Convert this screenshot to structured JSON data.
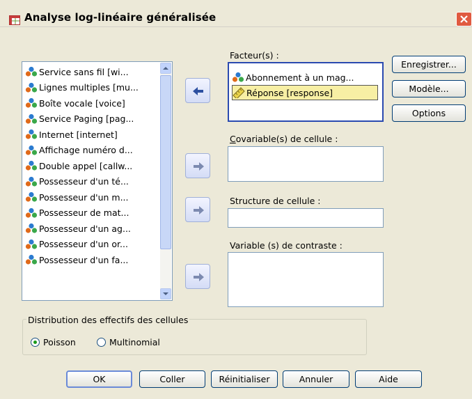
{
  "window": {
    "title": "Analyse log-linéaire généralisée"
  },
  "variables": [
    "Service sans fil [wi...",
    "Lignes multiples [mu...",
    "Boîte vocale [voice]",
    "Service Paging [pag...",
    "Internet [internet]",
    "Affichage numéro d...",
    "Double appel [callw...",
    "Possesseur  d'un té...",
    "Possesseur d'un m...",
    "Possesseur de mat...",
    "Possesseur d'un ag...",
    "Possesseur d'un or...",
    "Possesseur d'un fa..."
  ],
  "factors": {
    "label": "Facteur(s) :",
    "items": [
      "Abonnement à un mag...",
      "Réponse [response]"
    ]
  },
  "cell_covariates": {
    "label": "Covariable(s) de cellule :"
  },
  "cell_structure": {
    "label": "Structure de cellule :"
  },
  "contrast_variables": {
    "label": "Variable (s) de contraste :"
  },
  "side_buttons": {
    "save": "Enregistrer...",
    "model": "Modèle...",
    "options": "Options"
  },
  "distribution": {
    "legend": "Distribution des effectifs des cellules",
    "poisson": "Poisson",
    "multinomial": "Multinomial",
    "selected": "Poisson"
  },
  "footer": {
    "ok": "OK",
    "paste": "Coller",
    "reset": "Réinitialiser",
    "cancel": "Annuler",
    "help": "Aide"
  },
  "colors": {
    "accent": "#2a4ab0",
    "selection": "#f7efa4",
    "dialog_bg": "#ece9d8"
  },
  "icons": {
    "variable": "nominal-variable-icon",
    "scale": "scale-ruler-icon",
    "move": "arrow-right-icon"
  }
}
